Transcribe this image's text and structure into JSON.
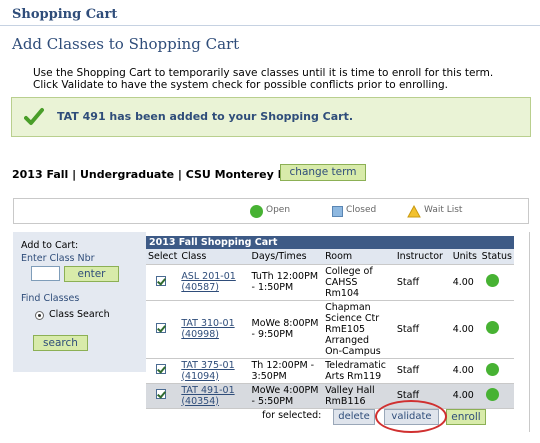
{
  "header": {
    "title": "Shopping Cart"
  },
  "page": {
    "title": "Add Classes to Shopping Cart",
    "instructions_line1": "Use the Shopping Cart to temporarily save classes until it is time to enroll for this term.",
    "instructions_line2": "Click Validate to have the system check for possible conflicts prior to enrolling."
  },
  "message": {
    "text": "TAT  491 has been added to your Shopping Cart.",
    "icon": "checkmark-icon"
  },
  "term": {
    "label": "2013 Fall | Undergraduate | CSU Monterey Bay",
    "change_button": "change term"
  },
  "legend": {
    "open": "Open",
    "closed": "Closed",
    "wait_list": "Wait List"
  },
  "add_panel": {
    "title": "Add to Cart:",
    "enter_class_nbr": "Enter Class Nbr",
    "enter_button": "enter",
    "find_classes": "Find Classes",
    "class_search": "Class Search",
    "search_button": "search"
  },
  "cart": {
    "header": "2013 Fall Shopping Cart",
    "columns": [
      "Select",
      "Class",
      "Days/Times",
      "Room",
      "Instructor",
      "Units",
      "Status"
    ],
    "rows": [
      {
        "class_line1": "ASL 201-01",
        "class_line2": "(40587)",
        "days1": "TuTh 12:00PM",
        "days2": "- 1:50PM",
        "room1": "College of",
        "room2": "CAHSS Rm104",
        "room3": "",
        "room4": "",
        "instructor": "Staff",
        "units": "4.00"
      },
      {
        "class_line1": "TAT 310-01",
        "class_line2": "(40998)",
        "days1": "MoWe 8:00PM",
        "days2": "- 9:50PM",
        "room1": "Chapman",
        "room2": "Science Ctr",
        "room3": "RmE105",
        "room4": "Arranged",
        "room5": "On-Campus",
        "instructor": "Staff",
        "units": "4.00"
      },
      {
        "class_line1": "TAT 375-01",
        "class_line2": "(41094)",
        "days1": "Th 12:00PM -",
        "days2": "3:50PM",
        "room1": "Teledramatic",
        "room2": "Arts Rm119",
        "room3": "",
        "room4": "",
        "instructor": "Staff",
        "units": "4.00"
      },
      {
        "class_line1": "TAT 491-01",
        "class_line2": "(40354)",
        "days1": "MoWe 4:00PM",
        "days2": "- 5:50PM",
        "room1": "Valley Hall",
        "room2": "RmB116",
        "room3": "",
        "room4": "",
        "instructor": "Staff",
        "units": "4.00"
      }
    ]
  },
  "actions": {
    "for_selected": "for selected:",
    "delete": "delete",
    "validate": "validate",
    "enroll": "enroll"
  },
  "colors": {
    "open_green": "#47b233",
    "header_blue": "#3d5a86",
    "title_blue": "#2f4d7a",
    "button_green": "#d8ebaa",
    "annotation_red": "#d03030"
  }
}
